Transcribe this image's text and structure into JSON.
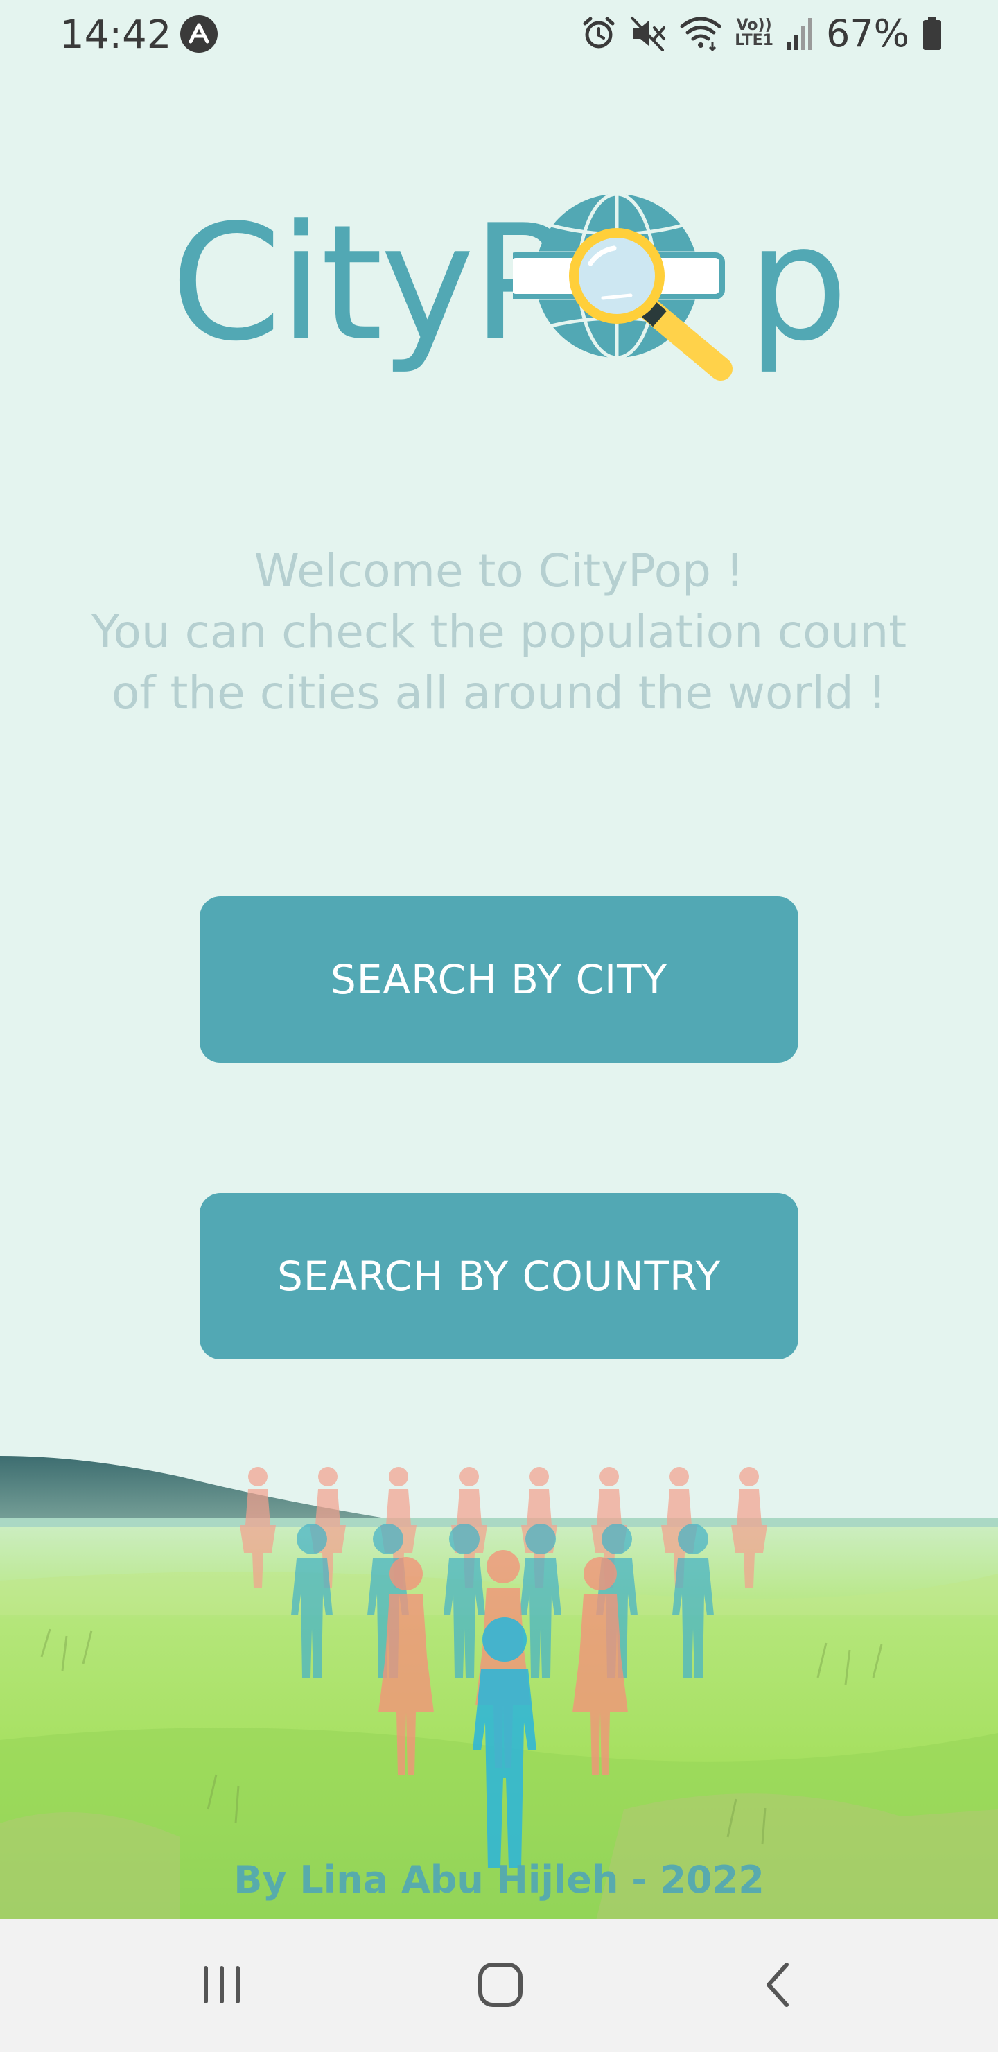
{
  "status_bar": {
    "time": "14:42",
    "battery_percent": "67%",
    "volte_line1": "Vo))",
    "volte_line2": "LTE1",
    "icons": [
      "app-notification-icon",
      "alarm-icon",
      "mute-icon",
      "wifi-icon",
      "volte-icon",
      "signal-icon",
      "battery-icon"
    ]
  },
  "logo": {
    "text_left": "CityP",
    "text_right": "p",
    "accent_color": "#52a8b4",
    "icon": "globe-magnifier-icon"
  },
  "welcome": {
    "line1": "Welcome to CityPop !",
    "line2": "You can check the population count",
    "line3": "of the cities all around the world !"
  },
  "buttons": {
    "search_city": "SEARCH BY CITY",
    "search_country": "SEARCH BY COUNTRY"
  },
  "footer": {
    "credit": "By Lina Abu Hijleh - 2022"
  },
  "nav": {
    "icons": [
      "recent-apps-icon",
      "home-icon",
      "back-icon"
    ]
  },
  "colors": {
    "background": "#e4f4ef",
    "button": "#52a8b4",
    "button_text": "#ffffff",
    "welcome_text": "#b5cfd0",
    "nav_background": "#f2f2f2"
  }
}
